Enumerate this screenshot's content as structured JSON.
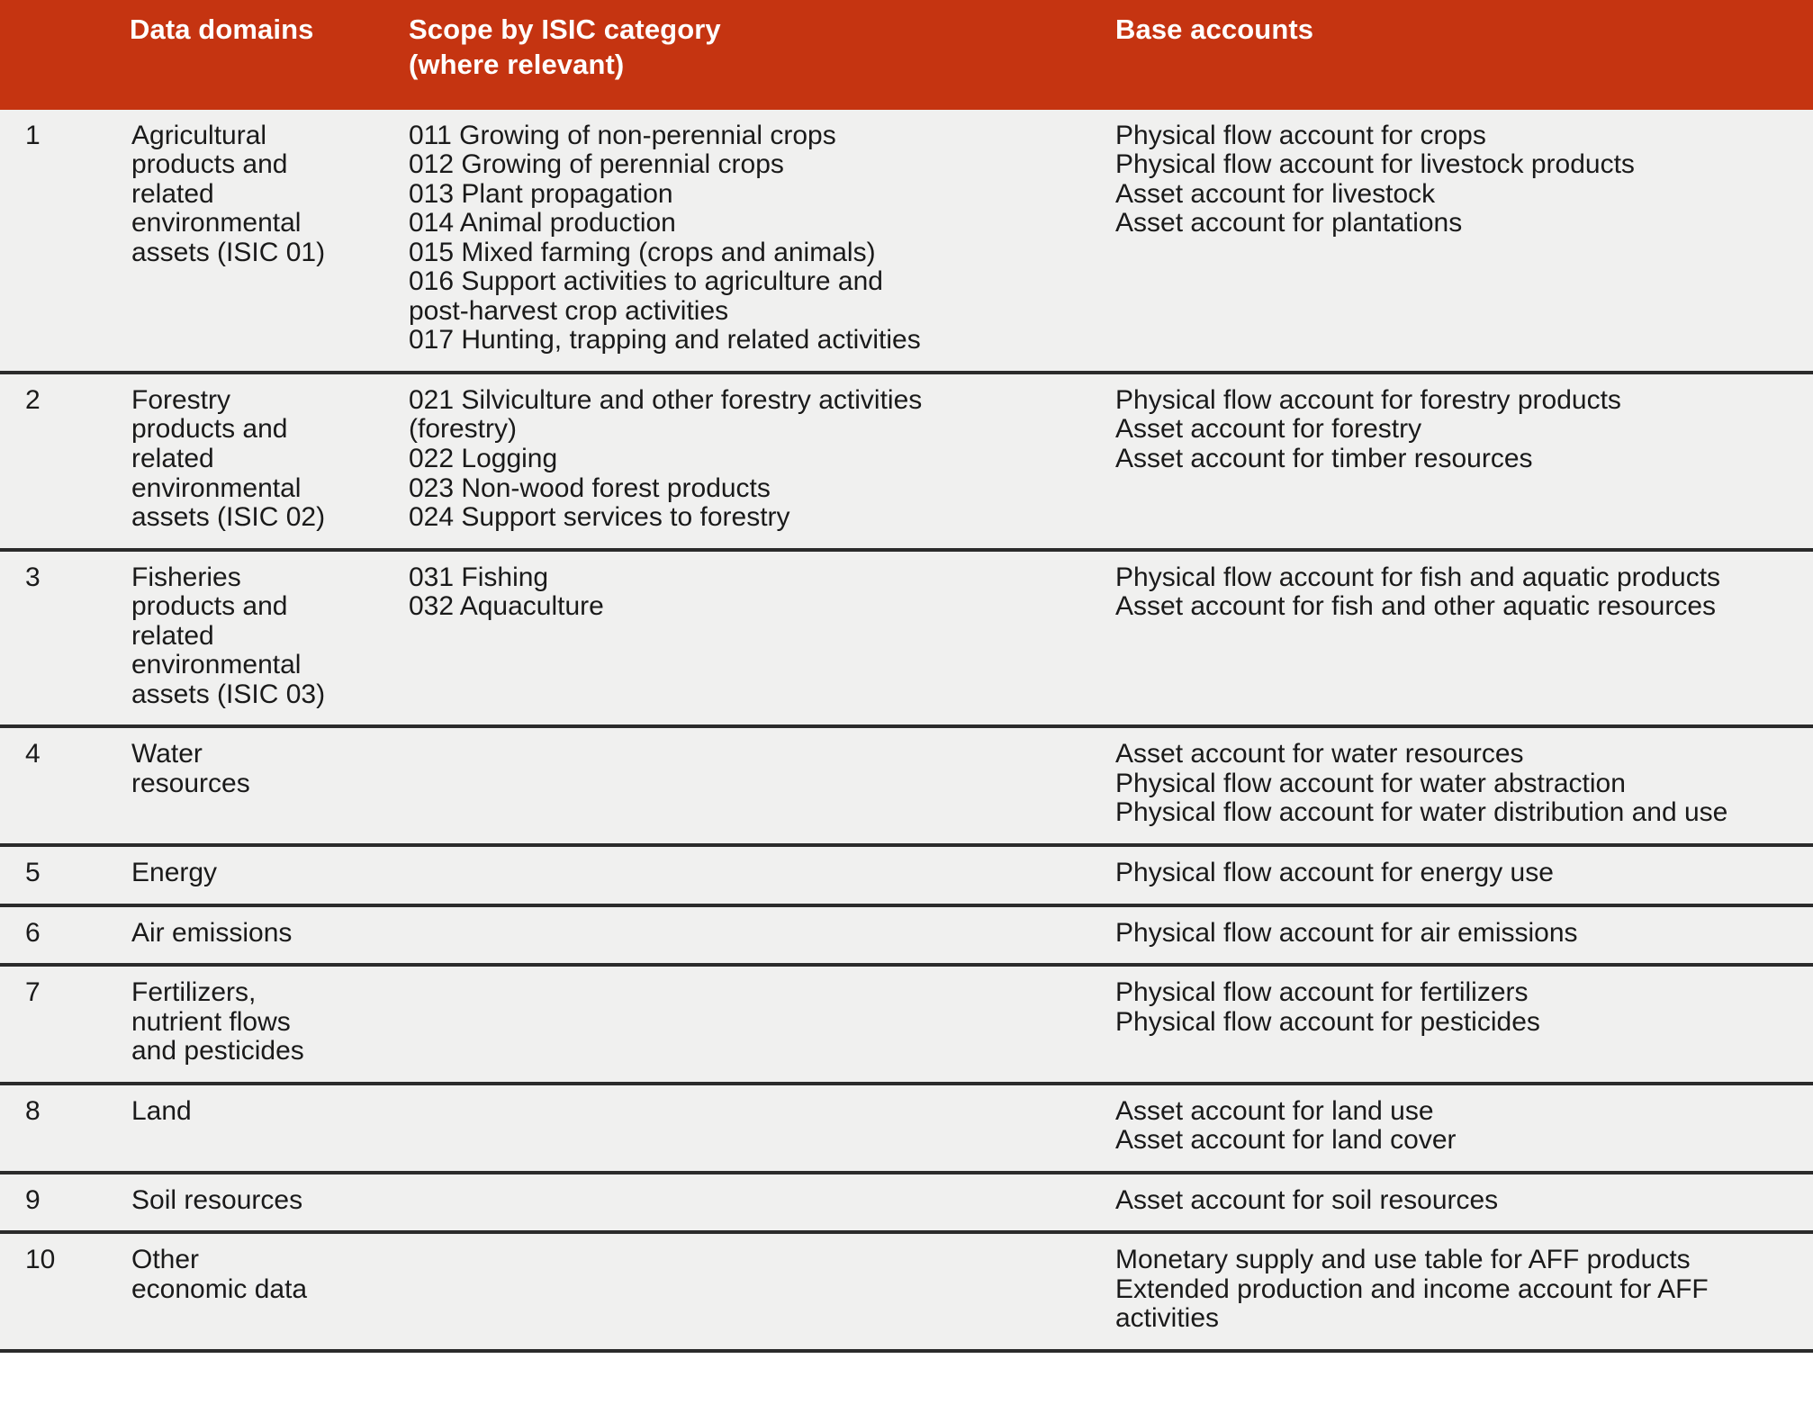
{
  "header": {
    "col_number": "",
    "col_domains": "Data domains",
    "col_scope_line1": "Scope by ISIC category",
    "col_scope_line2": "(where relevant)",
    "col_base": "Base accounts",
    "accent_color": "#c53411",
    "body_background": "#f0f0ef",
    "rule_color": "#2b2b2b"
  },
  "rows": [
    {
      "number": "1",
      "domain": "Agricultural\nproducts and\nrelated\nenvironmental\nassets (ISIC 01)",
      "scope": "011 Growing of non-perennial crops\n012 Growing of perennial crops\n013 Plant propagation\n014 Animal production\n015 Mixed farming (crops and animals)\n016 Support activities to agriculture and\npost-harvest crop activities\n017 Hunting, trapping and related activities",
      "base": "Physical flow account for crops\nPhysical flow account for livestock products\nAsset account for livestock\nAsset account for plantations"
    },
    {
      "number": "2",
      "domain": "Forestry\nproducts and\nrelated\nenvironmental\nassets (ISIC 02)",
      "scope": "021 Silviculture and other forestry activities\n(forestry)\n022 Logging\n023 Non-wood forest products\n024 Support services to forestry",
      "base": "Physical flow account for forestry products\nAsset account for forestry\nAsset account for timber resources"
    },
    {
      "number": "3",
      "domain": "Fisheries\nproducts and\nrelated\nenvironmental\nassets (ISIC 03)",
      "scope": "031 Fishing\n032 Aquaculture",
      "base": "Physical flow account for fish and aquatic products\nAsset account for fish and other aquatic resources"
    },
    {
      "number": "4",
      "domain": "Water\nresources",
      "scope": "",
      "base": "Asset account for water resources\nPhysical flow account for water abstraction\nPhysical flow account for water distribution and use"
    },
    {
      "number": "5",
      "domain": "Energy",
      "scope": "",
      "base": "Physical flow account for energy use"
    },
    {
      "number": "6",
      "domain": "Air emissions",
      "scope": "",
      "base": "Physical flow account for air emissions"
    },
    {
      "number": "7",
      "domain": "Fertilizers,\nnutrient flows\nand pesticides",
      "scope": "",
      "base": "Physical flow account for fertilizers\nPhysical flow account for pesticides"
    },
    {
      "number": "8",
      "domain": "Land",
      "scope": "",
      "base": "Asset account for land use\nAsset account for land cover"
    },
    {
      "number": "9",
      "domain": "Soil resources",
      "scope": "",
      "base": "Asset account for soil resources"
    },
    {
      "number": "10",
      "domain": "Other\neconomic data",
      "scope": "",
      "base": "Monetary supply and use table for AFF products\nExtended production and income account for AFF\nactivities"
    }
  ]
}
